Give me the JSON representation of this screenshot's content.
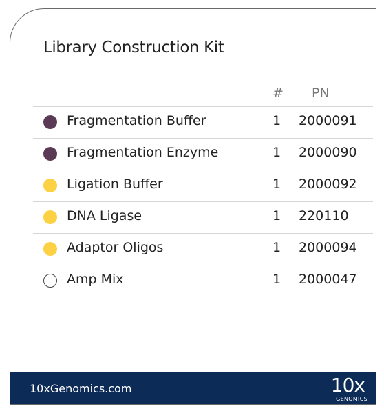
{
  "title": "Library Construction Kit",
  "columns": {
    "qty": "#",
    "pn": "PN"
  },
  "colors": {
    "purple": "#5b3a55",
    "yellow": "#fdd144",
    "empty": "#ffffff",
    "footer": "#0d2b57"
  },
  "items": [
    {
      "name": "Fragmentation Buffer",
      "qty": "1",
      "pn": "2000091",
      "dot": "purple"
    },
    {
      "name": "Fragmentation Enzyme",
      "qty": "1",
      "pn": "2000090",
      "dot": "purple"
    },
    {
      "name": "Ligation Buffer",
      "qty": "1",
      "pn": "2000092",
      "dot": "yellow"
    },
    {
      "name": "DNA Ligase",
      "qty": "1",
      "pn": "220110",
      "dot": "yellow"
    },
    {
      "name": "Adaptor Oligos",
      "qty": "1",
      "pn": "2000094",
      "dot": "yellow"
    },
    {
      "name": "Amp Mix",
      "qty": "1",
      "pn": "2000047",
      "dot": "empty"
    }
  ],
  "footer": {
    "site": "10xGenomics.com",
    "logo_main": "10x",
    "logo_sub": "GENOMICS"
  }
}
